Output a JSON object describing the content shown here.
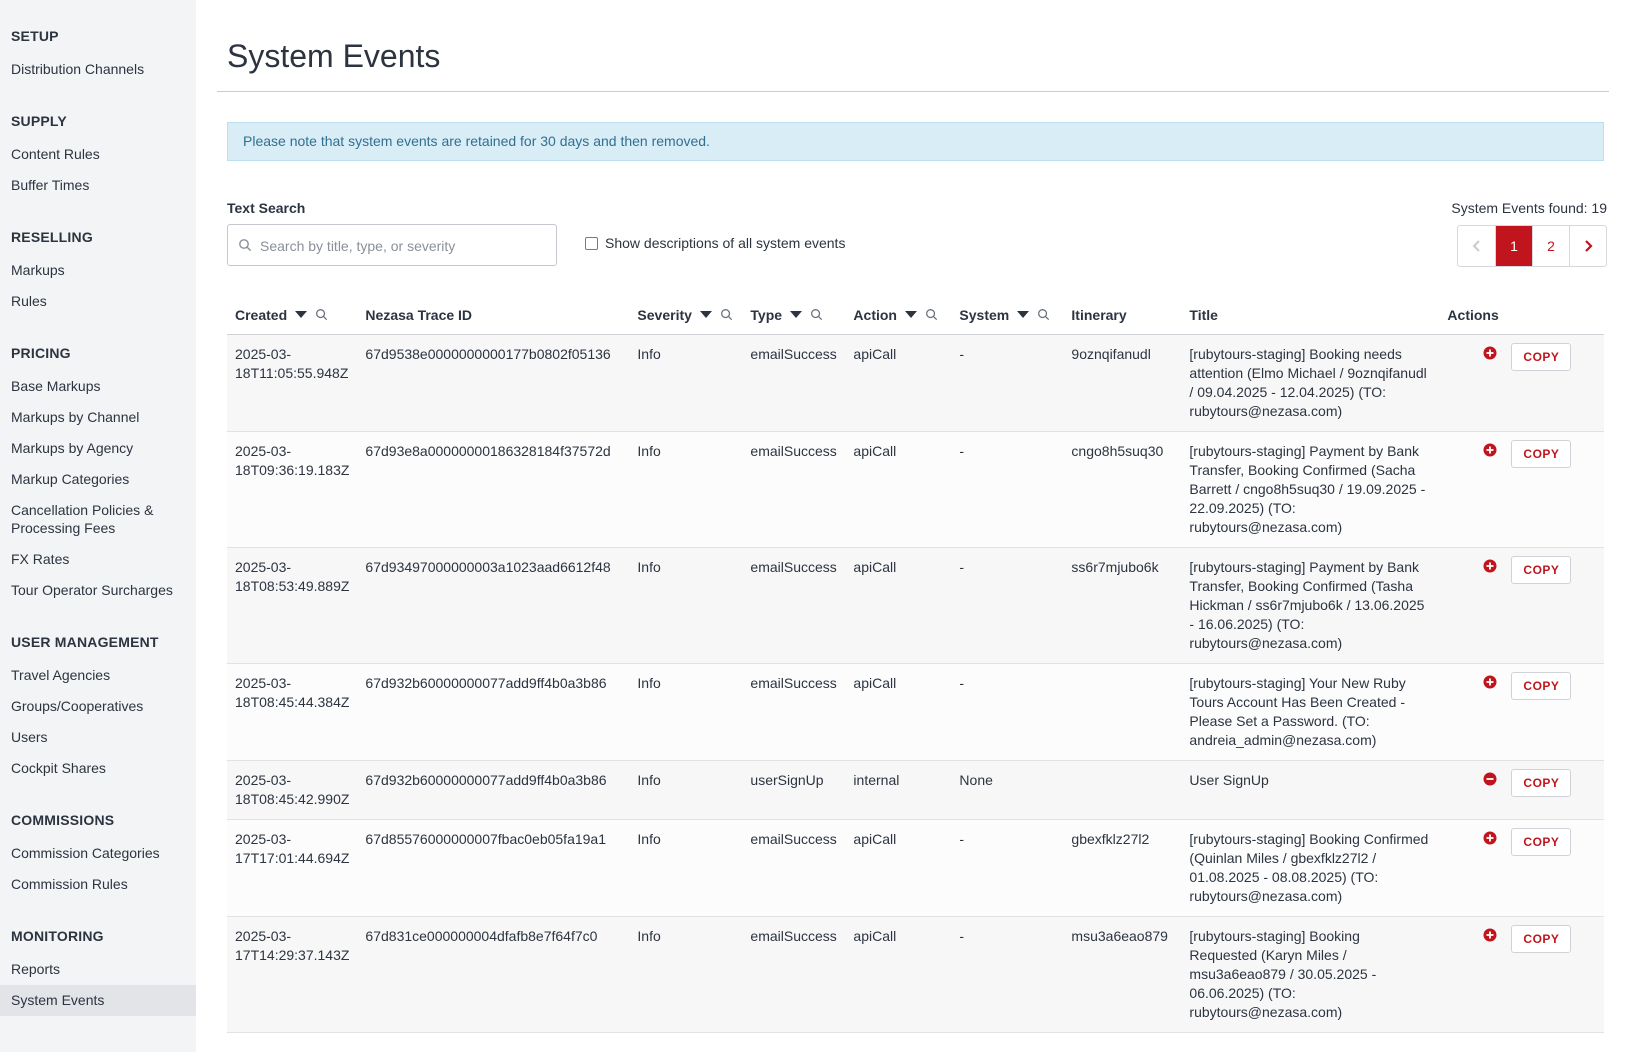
{
  "sidebar": {
    "sections": [
      {
        "heading": "SETUP",
        "items": [
          "Distribution Channels"
        ]
      },
      {
        "heading": "SUPPLY",
        "items": [
          "Content Rules",
          "Buffer Times"
        ]
      },
      {
        "heading": "RESELLING",
        "items": [
          "Markups",
          "Rules"
        ]
      },
      {
        "heading": "PRICING",
        "items": [
          "Base Markups",
          "Markups by Channel",
          "Markups by Agency",
          "Markup Categories",
          "Cancellation Policies & Processing Fees",
          "FX Rates",
          "Tour Operator Surcharges"
        ]
      },
      {
        "heading": "USER MANAGEMENT",
        "items": [
          "Travel Agencies",
          "Groups/Cooperatives",
          "Users",
          "Cockpit Shares"
        ]
      },
      {
        "heading": "COMMISSIONS",
        "items": [
          "Commission Categories",
          "Commission Rules"
        ]
      },
      {
        "heading": "MONITORING",
        "items": [
          "Reports",
          "System Events"
        ]
      }
    ],
    "active_item": "System Events"
  },
  "page": {
    "title": "System Events",
    "notice": "Please note that system events are retained for 30 days and then removed."
  },
  "search": {
    "label": "Text Search",
    "placeholder": "Search by title, type, or severity",
    "value": ""
  },
  "checkbox": {
    "label": "Show descriptions of all system events",
    "checked": false
  },
  "results": {
    "found_text": "System Events found: 19"
  },
  "pagination": {
    "pages": [
      "1",
      "2"
    ],
    "current": "1",
    "prev_icon": "chevron-left-icon",
    "next_icon": "chevron-right-icon"
  },
  "table": {
    "columns": [
      "Created",
      "Nezasa Trace ID",
      "Severity",
      "Type",
      "Action",
      "System",
      "Itinerary",
      "Title",
      "Actions"
    ],
    "copy_label": "COPY",
    "rows": [
      {
        "created": "2025-03-18T11:05:55.948Z",
        "trace": "67d9538e0000000000177b0802f05136",
        "severity": "Info",
        "type": "emailSuccess",
        "action": "apiCall",
        "system": "-",
        "itinerary": "9oznqifanudl",
        "title": "[rubytours-staging] Booking needs attention (Elmo Michael / 9oznqifanudl / 09.04.2025 - 12.04.2025) (TO: rubytours@nezasa.com)",
        "icon": "plus-circle-icon"
      },
      {
        "created": "2025-03-18T09:36:19.183Z",
        "trace": "67d93e8a00000000186328184f37572d",
        "severity": "Info",
        "type": "emailSuccess",
        "action": "apiCall",
        "system": "-",
        "itinerary": "cngo8h5suq30",
        "title": "[rubytours-staging] Payment by Bank Transfer, Booking Confirmed (Sacha Barrett / cngo8h5suq30 / 19.09.2025 - 22.09.2025) (TO: rubytours@nezasa.com)",
        "icon": "plus-circle-icon"
      },
      {
        "created": "2025-03-18T08:53:49.889Z",
        "trace": "67d93497000000003a1023aad6612f48",
        "severity": "Info",
        "type": "emailSuccess",
        "action": "apiCall",
        "system": "-",
        "itinerary": "ss6r7mjubo6k",
        "title": "[rubytours-staging] Payment by Bank Transfer, Booking Confirmed (Tasha Hickman / ss6r7mjubo6k / 13.06.2025 - 16.06.2025) (TO: rubytours@nezasa.com)",
        "icon": "plus-circle-icon"
      },
      {
        "created": "2025-03-18T08:45:44.384Z",
        "trace": "67d932b60000000077add9ff4b0a3b86",
        "severity": "Info",
        "type": "emailSuccess",
        "action": "apiCall",
        "system": "-",
        "itinerary": "",
        "title": "[rubytours-staging] Your New Ruby Tours Account Has Been Created - Please Set a Password. (TO: andreia_admin@nezasa.com)",
        "icon": "plus-circle-icon"
      },
      {
        "created": "2025-03-18T08:45:42.990Z",
        "trace": "67d932b60000000077add9ff4b0a3b86",
        "severity": "Info",
        "type": "userSignUp",
        "action": "internal",
        "system": "None",
        "itinerary": "",
        "title": "User SignUp",
        "icon": "minus-circle-icon"
      },
      {
        "created": "2025-03-17T17:01:44.694Z",
        "trace": "67d85576000000007fbac0eb05fa19a1",
        "severity": "Info",
        "type": "emailSuccess",
        "action": "apiCall",
        "system": "-",
        "itinerary": "gbexfklz27l2",
        "title": "[rubytours-staging] Booking Confirmed (Quinlan Miles / gbexfklz27l2 / 01.08.2025 - 08.08.2025) (TO: rubytours@nezasa.com)",
        "icon": "plus-circle-icon"
      },
      {
        "created": "2025-03-17T14:29:37.143Z",
        "trace": "67d831ce000000004dfafb8e7f64f7c0",
        "severity": "Info",
        "type": "emailSuccess",
        "action": "apiCall",
        "system": "-",
        "itinerary": "msu3a6eao879",
        "title": "[rubytours-staging] Booking Requested (Karyn Miles / msu3a6eao879 / 30.05.2025 - 06.06.2025) (TO: rubytours@nezasa.com)",
        "icon": "plus-circle-icon"
      }
    ]
  },
  "colors": {
    "accent": "#c0151d",
    "notice_bg": "#d9edf7",
    "notice_text": "#31708f",
    "sidebar_bg": "#f3f4f6"
  }
}
